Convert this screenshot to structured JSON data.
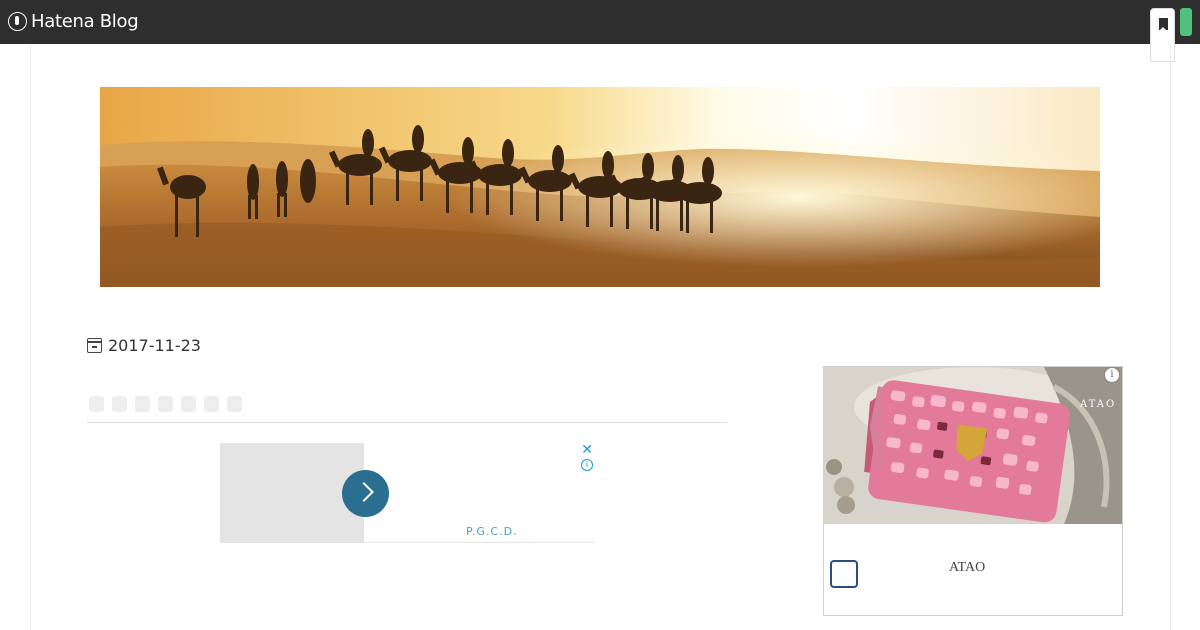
{
  "topbar": {
    "brand": "Hatena Blog",
    "colors": {
      "background": "#2e2e2e",
      "accent": "#4fc07e"
    }
  },
  "article": {
    "date": "2017-11-23"
  },
  "ad_inline": {
    "close_glyph": "✕",
    "info_glyph": "i",
    "advertiser": "P.G.C.D.",
    "button_color": "#2a6f8f"
  },
  "ad_sidebar": {
    "logo": "ATAO",
    "label": "ATAO",
    "info_glyph": "i"
  }
}
